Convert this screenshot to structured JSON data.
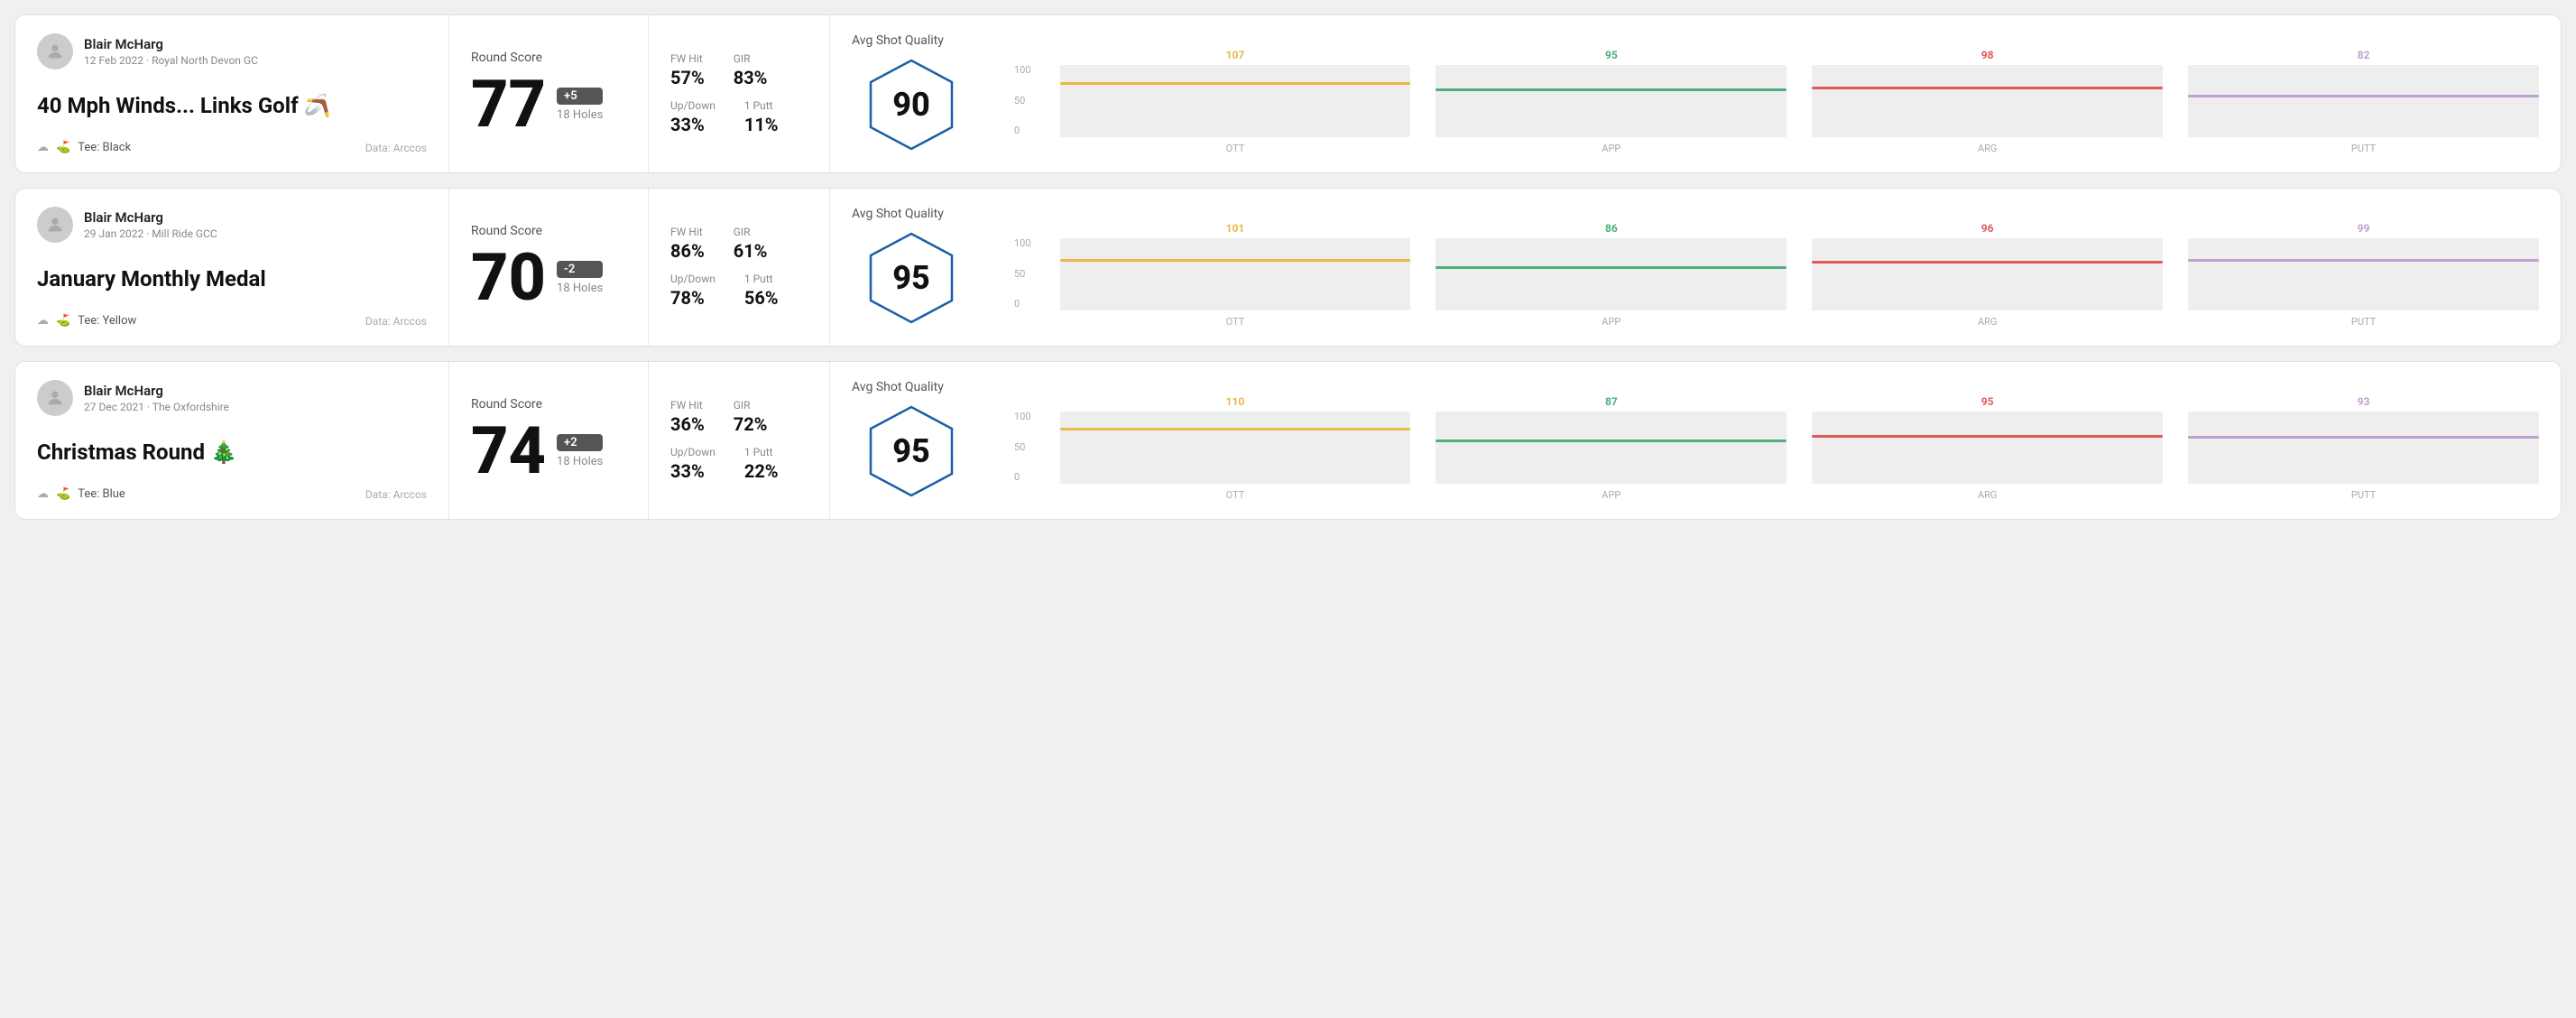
{
  "rounds": [
    {
      "id": "round1",
      "user": {
        "name": "Blair McHarg",
        "date": "12 Feb 2022",
        "course": "Royal North Devon GC"
      },
      "title": "40 Mph Winds... Links Golf 🪃",
      "tee": "Black",
      "data_source": "Data: Arccos",
      "score": {
        "value": "77",
        "badge": "+5",
        "badge_type": "over",
        "holes": "18 Holes"
      },
      "stats": {
        "fw_hit_label": "FW Hit",
        "fw_hit_value": "57%",
        "gir_label": "GIR",
        "gir_value": "83%",
        "updown_label": "Up/Down",
        "updown_value": "33%",
        "oneputt_label": "1 Putt",
        "oneputt_value": "11%"
      },
      "quality": {
        "label": "Avg Shot Quality",
        "value": "90"
      },
      "chart": {
        "bars": [
          {
            "label": "OTT",
            "value": 107,
            "color": "#e8b84b",
            "height_pct": 72
          },
          {
            "label": "APP",
            "value": 95,
            "color": "#4caf7d",
            "height_pct": 64
          },
          {
            "label": "ARG",
            "value": 98,
            "color": "#e05a5a",
            "height_pct": 66
          },
          {
            "label": "PUTT",
            "value": 82,
            "color": "#c0a0d0",
            "height_pct": 55
          }
        ],
        "y_labels": [
          "100",
          "50",
          "0"
        ]
      }
    },
    {
      "id": "round2",
      "user": {
        "name": "Blair McHarg",
        "date": "29 Jan 2022",
        "course": "Mill Ride GCC"
      },
      "title": "January Monthly Medal",
      "tee": "Yellow",
      "data_source": "Data: Arccos",
      "score": {
        "value": "70",
        "badge": "-2",
        "badge_type": "under",
        "holes": "18 Holes"
      },
      "stats": {
        "fw_hit_label": "FW Hit",
        "fw_hit_value": "86%",
        "gir_label": "GIR",
        "gir_value": "61%",
        "updown_label": "Up/Down",
        "updown_value": "78%",
        "oneputt_label": "1 Putt",
        "oneputt_value": "56%"
      },
      "quality": {
        "label": "Avg Shot Quality",
        "value": "95"
      },
      "chart": {
        "bars": [
          {
            "label": "OTT",
            "value": 101,
            "color": "#e8b84b",
            "height_pct": 68
          },
          {
            "label": "APP",
            "value": 86,
            "color": "#4caf7d",
            "height_pct": 58
          },
          {
            "label": "ARG",
            "value": 96,
            "color": "#e05a5a",
            "height_pct": 65
          },
          {
            "label": "PUTT",
            "value": 99,
            "color": "#c0a0d0",
            "height_pct": 67
          }
        ],
        "y_labels": [
          "100",
          "50",
          "0"
        ]
      }
    },
    {
      "id": "round3",
      "user": {
        "name": "Blair McHarg",
        "date": "27 Dec 2021",
        "course": "The Oxfordshire"
      },
      "title": "Christmas Round 🎄",
      "tee": "Blue",
      "data_source": "Data: Arccos",
      "score": {
        "value": "74",
        "badge": "+2",
        "badge_type": "over",
        "holes": "18 Holes"
      },
      "stats": {
        "fw_hit_label": "FW Hit",
        "fw_hit_value": "36%",
        "gir_label": "GIR",
        "gir_value": "72%",
        "updown_label": "Up/Down",
        "updown_value": "33%",
        "oneputt_label": "1 Putt",
        "oneputt_value": "22%"
      },
      "quality": {
        "label": "Avg Shot Quality",
        "value": "95"
      },
      "chart": {
        "bars": [
          {
            "label": "OTT",
            "value": 110,
            "color": "#e8b84b",
            "height_pct": 74
          },
          {
            "label": "APP",
            "value": 87,
            "color": "#4caf7d",
            "height_pct": 58
          },
          {
            "label": "ARG",
            "value": 95,
            "color": "#e05a5a",
            "height_pct": 64
          },
          {
            "label": "PUTT",
            "value": 93,
            "color": "#c0a0d0",
            "height_pct": 63
          }
        ],
        "y_labels": [
          "100",
          "50",
          "0"
        ]
      }
    }
  ]
}
